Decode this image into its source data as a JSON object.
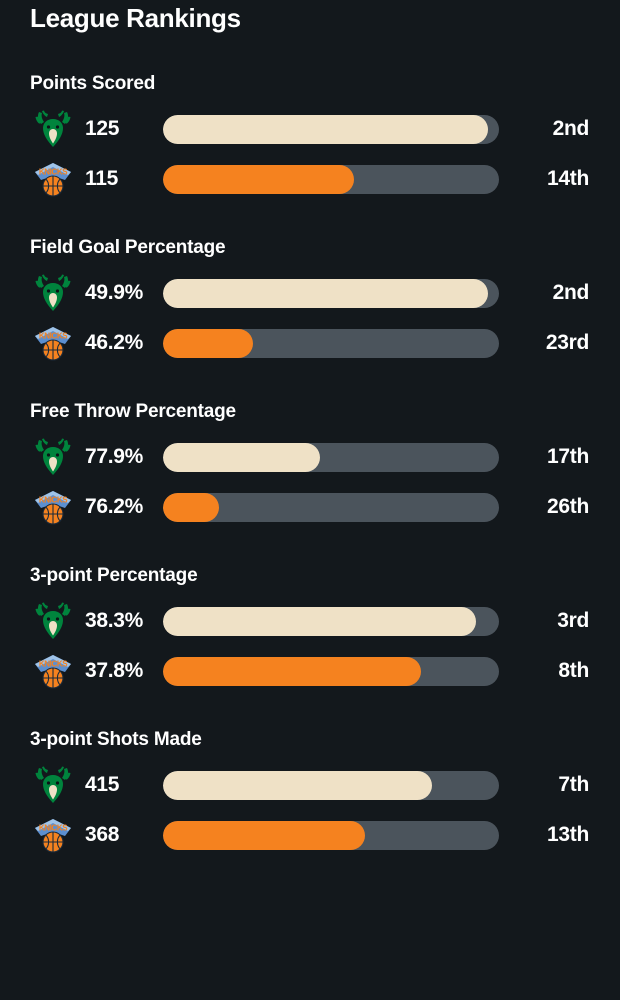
{
  "header": {
    "title": "League Rankings"
  },
  "colors": {
    "background": "#13181C",
    "bar_track": "#4B545C",
    "bucks_fill": "#EFE1C6",
    "knicks_fill": "#F5821F",
    "text": "#FFFFFF"
  },
  "teams": {
    "bucks": {
      "name": "Milwaukee Bucks",
      "logo": "bucks-logo",
      "fill": "cream"
    },
    "knicks": {
      "name": "New York Knicks",
      "logo": "knicks-logo",
      "fill": "orange"
    }
  },
  "chart_data": {
    "type": "bar",
    "title": "League Rankings",
    "orientation": "horizontal",
    "scale_note": "bar fill fraction = (31 - rank) / 30, league of 30 teams",
    "legend": [
      "Milwaukee Bucks",
      "New York Knicks"
    ],
    "sections": [
      {
        "label": "Points Scored",
        "rows": [
          {
            "team": "bucks",
            "value": "125",
            "numeric": 125,
            "rank": "2nd",
            "rank_num": 2,
            "fill_pct": 96.7
          },
          {
            "team": "knicks",
            "value": "115",
            "numeric": 115,
            "rank": "14th",
            "rank_num": 14,
            "fill_pct": 56.7
          }
        ]
      },
      {
        "label": "Field Goal Percentage",
        "rows": [
          {
            "team": "bucks",
            "value": "49.9%",
            "numeric": 49.9,
            "rank": "2nd",
            "rank_num": 2,
            "fill_pct": 96.7
          },
          {
            "team": "knicks",
            "value": "46.2%",
            "numeric": 46.2,
            "rank": "23rd",
            "rank_num": 23,
            "fill_pct": 26.7
          }
        ]
      },
      {
        "label": "Free Throw Percentage",
        "rows": [
          {
            "team": "bucks",
            "value": "77.9%",
            "numeric": 77.9,
            "rank": "17th",
            "rank_num": 17,
            "fill_pct": 46.7
          },
          {
            "team": "knicks",
            "value": "76.2%",
            "numeric": 76.2,
            "rank": "26th",
            "rank_num": 26,
            "fill_pct": 16.7
          }
        ]
      },
      {
        "label": "3-point Percentage",
        "rows": [
          {
            "team": "bucks",
            "value": "38.3%",
            "numeric": 38.3,
            "rank": "3rd",
            "rank_num": 3,
            "fill_pct": 93.3
          },
          {
            "team": "knicks",
            "value": "37.8%",
            "numeric": 37.8,
            "rank": "8th",
            "rank_num": 8,
            "fill_pct": 76.7
          }
        ]
      },
      {
        "label": "3-point Shots Made",
        "rows": [
          {
            "team": "bucks",
            "value": "415",
            "numeric": 415,
            "rank": "7th",
            "rank_num": 7,
            "fill_pct": 80.0
          },
          {
            "team": "knicks",
            "value": "368",
            "numeric": 368,
            "rank": "13th",
            "rank_num": 13,
            "fill_pct": 60.0
          }
        ]
      }
    ]
  }
}
